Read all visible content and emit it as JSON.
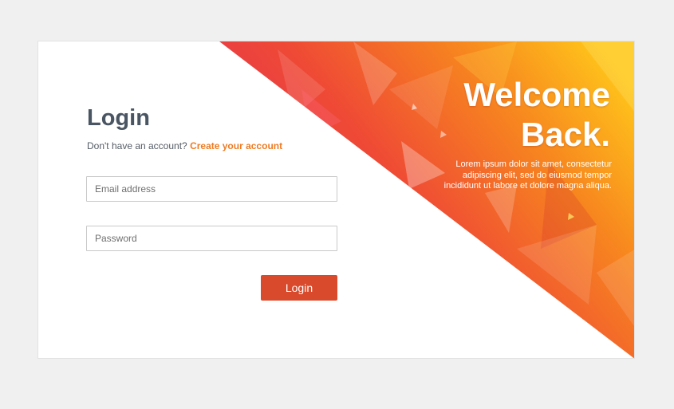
{
  "login": {
    "title": "Login",
    "no_account_text": "Don't have an account?",
    "create_account_link": "Create your account",
    "email_placeholder": "Email address",
    "password_placeholder": "Password",
    "submit_label": "Login"
  },
  "welcome": {
    "title_line1": "Welcome",
    "title_line2": "Back.",
    "body": "Lorem ipsum dolor sit amet, consectetur adipiscing elit, sed do eiusmod tempor incididunt ut labore et dolore magna aliqua."
  },
  "colors": {
    "page_background": "#f0f0f0",
    "card_background": "#ffffff",
    "title_text": "#4a5563",
    "link_accent": "#ef7b22",
    "button_background": "#d84a2b",
    "gradient_start": "#e0245e",
    "gradient_mid": "#f0542a",
    "gradient_end": "#ffc61a"
  }
}
